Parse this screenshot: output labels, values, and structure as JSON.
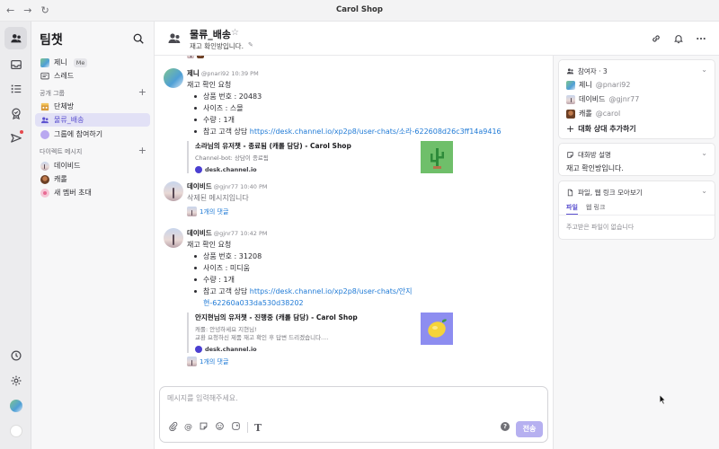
{
  "window": {
    "title": "Carol Shop",
    "nav": [
      "←",
      "→",
      "↻"
    ]
  },
  "sidebar": {
    "title": "팀챗",
    "items_top": [
      {
        "label": "제니",
        "badge": "Me"
      },
      {
        "label": "스레드"
      }
    ],
    "groups_label": "공개 그룹",
    "groups": [
      {
        "label": "단체방"
      },
      {
        "label": "물류_배송"
      },
      {
        "label": "그룹에 참여하기"
      }
    ],
    "dm_label": "다이렉트 메시지",
    "dms": [
      {
        "label": "데이비드"
      },
      {
        "label": "캐롤"
      },
      {
        "label": "새 멤버 초대"
      }
    ]
  },
  "chat": {
    "title": "물류_배송",
    "description": "재고 확인방입니다.",
    "messages": [
      {
        "author": "제니",
        "meta": "@pnari92 10:39 PM",
        "text": "재고 확인 요청",
        "bullets": [
          "상품 번호 : 20483",
          "사이즈 : 스몰",
          "수량 : 1개"
        ],
        "link_prefix": "참고 고객 상담 ",
        "link": "https://desk.channel.io/xp2p8/user-chats/소라-622608d26c3ff14a9416",
        "card": {
          "title": "소라님의 유저챗 - 종료됨 (캐롤 담당) - Carol Shop",
          "desc1": "Channel-bot: 상담이 종료됨",
          "desc2": "",
          "site": "desk.channel.io",
          "thumb": "cactus"
        }
      },
      {
        "author": "데이비드",
        "meta": "@gjnr77 10:40 PM",
        "text": "삭제된 메시지입니다",
        "replies": "1개의 댓글"
      },
      {
        "author": "데이비드",
        "meta": "@gjnr77 10:42 PM",
        "text": "재고 확인 요청",
        "bullets": [
          "상품 번호 : 31208",
          "사이즈 : 미디움",
          "수량 : 1개"
        ],
        "link_prefix": "참고 고객 상담 ",
        "link_line1": "https://desk.channel.io/xp2p8/user-chats/안지",
        "link_line2": "현-62260a033da530d38202",
        "card": {
          "title": "안지현님의 유저챗 - 진행중 (캐롤 담당) - Carol Shop",
          "desc1": "캐롤: 안녕하세요 지현님!",
          "desc2": "교환 요청하신 제품 재고 확인 후 답변 드리겠습니다....",
          "site": "desk.channel.io",
          "thumb": "lemon"
        },
        "replies": "1개의 댓글"
      }
    ],
    "composer": {
      "placeholder": "메시지를 입력해주세요.",
      "send": "전송",
      "help": "?"
    }
  },
  "right_panel": {
    "participants_label": "참여자 · 3",
    "participants": [
      {
        "name": "제니",
        "handle": "@pnari92"
      },
      {
        "name": "데이비드",
        "handle": "@gjnr77"
      },
      {
        "name": "캐롤",
        "handle": "@carol"
      }
    ],
    "add_participant": "대화 상대 추가하기",
    "description_label": "대화방 설명",
    "description": "재고 확인방입니다.",
    "files_label": "파일, 웹 링크 모아보기",
    "tabs": [
      "파일",
      "웹 링크"
    ],
    "empty": "주고받은 파일이 없습니다"
  },
  "colors": {
    "accent": "#5a4fcf",
    "link": "#1f7ad6",
    "send_disabled": "#b6b0f0"
  }
}
